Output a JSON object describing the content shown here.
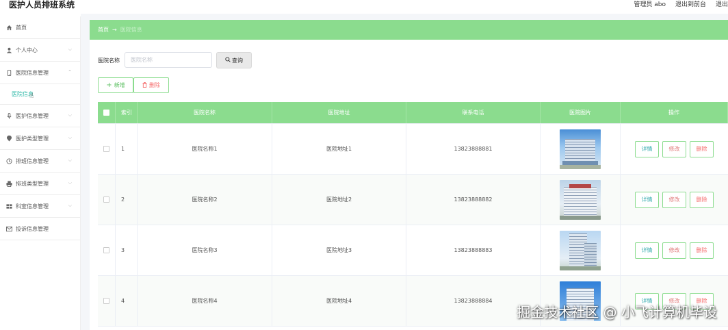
{
  "app": {
    "title": "医护人员排班系统"
  },
  "topbar": {
    "user": "管理员 abo",
    "frontend_link": "退出到前台",
    "logout_partial": "退出"
  },
  "sidebar": {
    "items": [
      {
        "label": "首页",
        "icon": "home-icon"
      },
      {
        "label": "个人中心",
        "icon": "user-icon"
      },
      {
        "label": "医院信息管理",
        "icon": "phone-icon",
        "expanded": true
      },
      {
        "label": "医护信息管理",
        "icon": "mic-icon"
      },
      {
        "label": "医护类型管理",
        "icon": "location-icon"
      },
      {
        "label": "排班信息管理",
        "icon": "clock-icon"
      },
      {
        "label": "排班类型管理",
        "icon": "printer-icon"
      },
      {
        "label": "科室信息管理",
        "icon": "grid-icon"
      },
      {
        "label": "投诉信息管理",
        "icon": "mail-icon"
      }
    ],
    "sub_item": {
      "label": "医院信息"
    }
  },
  "breadcrumb": {
    "home": "首页",
    "arrow": "→",
    "current": "医院信息"
  },
  "search": {
    "label": "医院名称",
    "placeholder": "医院名称",
    "button": "查询"
  },
  "actions": {
    "add": "新增",
    "delete": "删除"
  },
  "table": {
    "headers": {
      "index": "索引",
      "name": "医院名称",
      "address": "医院地址",
      "phone": "联系电话",
      "image": "医院图片",
      "ops": "操作"
    },
    "rows": [
      {
        "index": "1",
        "name": "医院名称1",
        "address": "医院地址1",
        "phone": "13823888881"
      },
      {
        "index": "2",
        "name": "医院名称2",
        "address": "医院地址2",
        "phone": "13823888882"
      },
      {
        "index": "3",
        "name": "医院名称3",
        "address": "医院地址3",
        "phone": "13823888883"
      },
      {
        "index": "4",
        "name": "医院名称4",
        "address": "医院地址4",
        "phone": "13823888884"
      }
    ],
    "op_labels": {
      "detail": "详情",
      "edit": "修改",
      "delete": "删除"
    }
  },
  "watermark": "掘金技术社区 @ 小飞计算机毕设",
  "colors": {
    "accent": "#8bdc8e",
    "danger": "#f56c6c",
    "link": "#2fb9a8"
  }
}
